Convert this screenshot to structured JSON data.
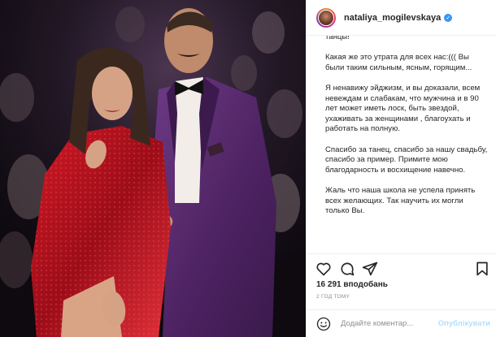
{
  "post": {
    "username": "nataliya_mogilevskaya",
    "verified": true,
    "caption": [
      "танцы!",
      "Какая же это утрата для всех нас:((( Вы были таким сильным, ясным, горящим...",
      "Я ненавижу эйджизм, и вы доказали, всем невеждам и слабакам, что мужчина и в 90 лет может иметь лоск, быть звездой, ухаживать за женщинами , благоухать и работать на полную.",
      "Спасибо за танец, спасибо за нашу свадьбу, спасибо за пример. Примите мою благодарность и восхищение навечно.",
      "Жаль что наша школа не успела принять всех желающих. Так научить их могли только Вы."
    ],
    "likes": "16 291 вподобань",
    "time_ago": "2 ГОД ТОМУ",
    "comment_placeholder": "Додайте коментар...",
    "post_button": "Опублікувати"
  },
  "icons": {
    "like": "heart-icon",
    "comment": "comment-icon",
    "share": "share-icon",
    "save": "bookmark-icon",
    "emoji": "emoji-icon",
    "verified": "verified-badge-icon"
  },
  "colors": {
    "accent_blue": "#3897f0",
    "post_button_disabled": "#b2dffc",
    "muted_text": "#8e8e8e",
    "text": "#262626",
    "dress_red": "#b3121c",
    "suit_purple": "#5a2a6e"
  }
}
